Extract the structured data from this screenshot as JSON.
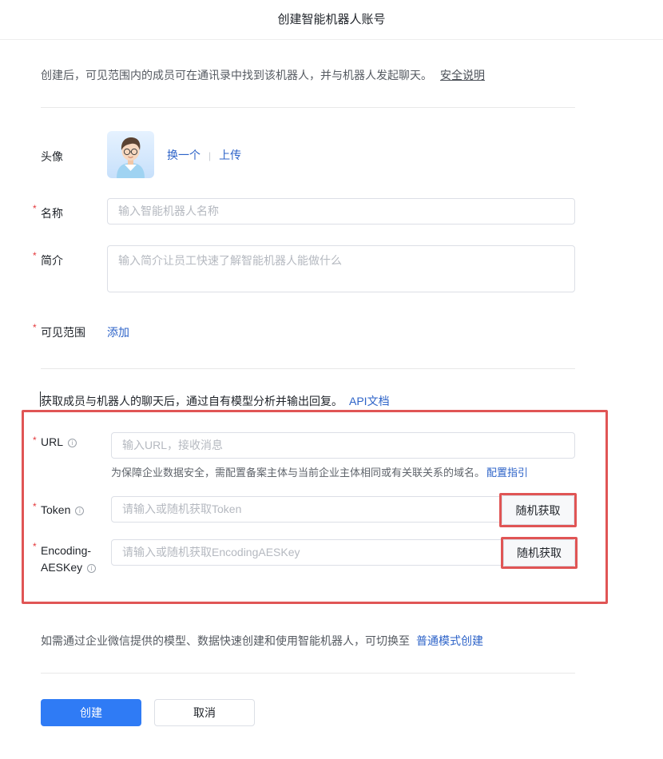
{
  "page": {
    "title": "创建智能机器人账号"
  },
  "intro": {
    "text": "创建后，可见范围内的成员可在通讯录中找到该机器人，并与机器人发起聊天。",
    "link": "安全说明"
  },
  "avatar": {
    "label": "头像",
    "change": "换一个",
    "upload": "上传"
  },
  "name": {
    "label": "名称",
    "placeholder": "输入智能机器人名称"
  },
  "intro_field": {
    "label": "简介",
    "placeholder": "输入简介让员工快速了解智能机器人能做什么"
  },
  "scope": {
    "label": "可见范围",
    "add": "添加"
  },
  "api_section": {
    "desc": "获取成员与机器人的聊天后，通过自有模型分析并输出回复。",
    "api_link": "API文档"
  },
  "url": {
    "label": "URL",
    "placeholder": "输入URL，接收消息",
    "hint": "为保障企业数据安全，需配置备案主体与当前企业主体相同或有关联关系的域名。",
    "hint_link": "配置指引"
  },
  "token": {
    "label": "Token",
    "placeholder": "请输入或随机获取Token",
    "random": "随机获取"
  },
  "aes": {
    "label_line1": "Encoding-",
    "label_line2": "AESKey",
    "placeholder": "请输入或随机获取EncodingAESKey",
    "random": "随机获取"
  },
  "switch": {
    "text": "如需通过企业微信提供的模型、数据快速创建和使用智能机器人，可切换至",
    "link": "普通模式创建"
  },
  "actions": {
    "create": "创建",
    "cancel": "取消"
  },
  "required_mark": "*",
  "info_glyph": "i",
  "colors": {
    "primary": "#2f7bf5",
    "link": "#2d63c8",
    "highlight": "#e05555",
    "required": "#e4393c"
  }
}
